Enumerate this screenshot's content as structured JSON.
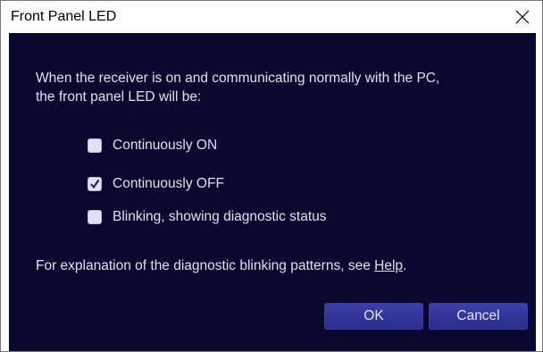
{
  "window": {
    "title": "Front Panel LED"
  },
  "dialog": {
    "message_line1": "When the receiver is on and communicating normally with the PC,",
    "message_line2": "the front panel LED will be:",
    "options": [
      {
        "label": "Continuously ON",
        "checked": false
      },
      {
        "label": "Continuously OFF",
        "checked": true
      },
      {
        "label": "Blinking, showing diagnostic status",
        "checked": false
      }
    ],
    "help_text": "For explanation of the diagnostic blinking patterns, see ",
    "help_link": "Help",
    "help_suffix": "."
  },
  "buttons": {
    "ok_label": "OK",
    "cancel_label": "Cancel"
  },
  "colors": {
    "panel_background": "#07072f",
    "button_fill": "#2f33a0",
    "text": "#e0e0ea"
  },
  "icons": {
    "close": "close-icon",
    "check": "checkmark-icon"
  }
}
